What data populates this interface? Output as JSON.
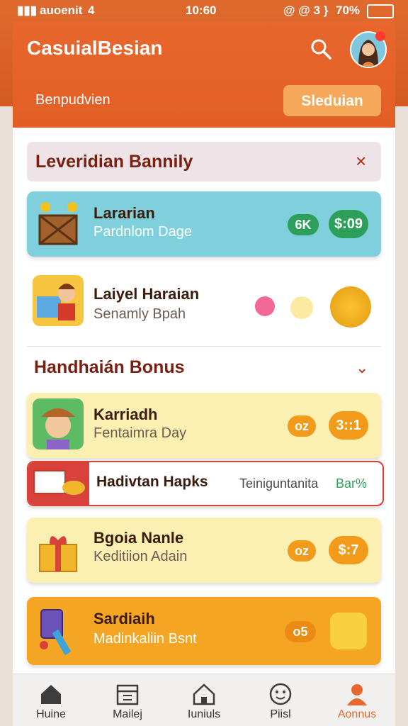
{
  "status": {
    "carrier": "auoenit",
    "signal": "4",
    "time": "10:60",
    "icons": "@ @ 3 }",
    "battery": "70%"
  },
  "header": {
    "title": "CasuialBesian",
    "subtitle": "Benpudvien",
    "action_button": "Sleduian"
  },
  "banner": {
    "title": "Leveridian Bannily",
    "close": "×"
  },
  "cards_top": [
    {
      "title": "Lararian",
      "subtitle": "Pardnlom Dage",
      "badge": "6K",
      "price": "$:09",
      "color": "#7fd0dc"
    },
    {
      "title": "Laiyel Haraian",
      "subtitle": "Senamly Bpah"
    }
  ],
  "section": {
    "title": "Handhaián Bonus",
    "chevron": "⌄"
  },
  "cards_bottom": [
    {
      "title": "Karriadh",
      "subtitle": "Fentaimra Day",
      "badge": "oz",
      "price": "3::1"
    },
    {
      "title": "Hadivtan Hapks",
      "right_text": "Teiniguntanita",
      "right_tag": "Bar%"
    },
    {
      "title": "Bgoia Nanle",
      "subtitle": "Keditiion Adain",
      "badge": "oz",
      "price": "$:7"
    },
    {
      "title": "Sardiaih",
      "subtitle": "Madinkaliin Bsnt",
      "badge": "o5"
    }
  ],
  "nav": [
    {
      "label": "Huine",
      "icon": "home-icon"
    },
    {
      "label": "Mailej",
      "icon": "calendar-icon"
    },
    {
      "label": "Iuniuls",
      "icon": "house-icon"
    },
    {
      "label": "Piisl",
      "icon": "smiley-icon"
    },
    {
      "label": "Aonnus",
      "icon": "person-icon",
      "active": true
    }
  ]
}
